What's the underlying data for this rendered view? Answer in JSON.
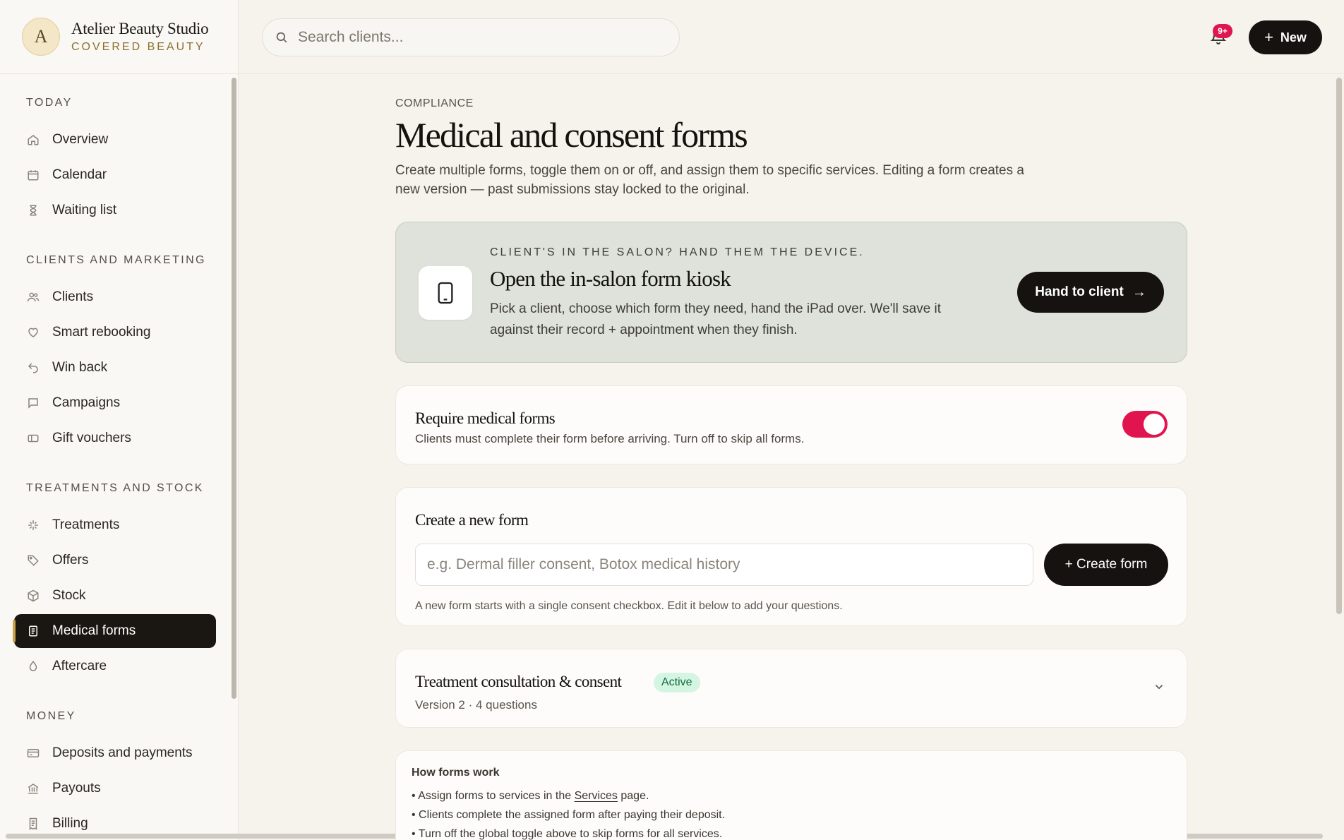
{
  "brand": {
    "initial": "A",
    "name": "Atelier Beauty Studio",
    "subtitle": "COVERED BEAUTY"
  },
  "search": {
    "placeholder": "Search clients..."
  },
  "topbar": {
    "notifications_badge": "9+",
    "new_label": "New"
  },
  "sidebar": {
    "sections": [
      {
        "title": "TODAY",
        "items": [
          {
            "label": "Overview",
            "icon": "home-icon"
          },
          {
            "label": "Calendar",
            "icon": "calendar-icon"
          },
          {
            "label": "Waiting list",
            "icon": "hourglass-icon"
          }
        ]
      },
      {
        "title": "CLIENTS AND MARKETING",
        "items": [
          {
            "label": "Clients",
            "icon": "users-icon"
          },
          {
            "label": "Smart rebooking",
            "icon": "heart-icon"
          },
          {
            "label": "Win back",
            "icon": "undo-icon"
          },
          {
            "label": "Campaigns",
            "icon": "message-icon"
          },
          {
            "label": "Gift vouchers",
            "icon": "voucher-icon"
          }
        ]
      },
      {
        "title": "TREATMENTS AND STOCK",
        "items": [
          {
            "label": "Treatments",
            "icon": "sparkle-icon"
          },
          {
            "label": "Offers",
            "icon": "tag-icon"
          },
          {
            "label": "Stock",
            "icon": "box-icon"
          },
          {
            "label": "Medical forms",
            "icon": "document-icon",
            "active": true
          },
          {
            "label": "Aftercare",
            "icon": "drop-icon"
          }
        ]
      },
      {
        "title": "MONEY",
        "items": [
          {
            "label": "Deposits and payments",
            "icon": "card-icon"
          },
          {
            "label": "Payouts",
            "icon": "bank-icon"
          },
          {
            "label": "Billing",
            "icon": "receipt-icon"
          }
        ]
      }
    ]
  },
  "main": {
    "eyebrow": "COMPLIANCE",
    "title": "Medical and consent forms",
    "description": "Create multiple forms, toggle them on or off, and assign them to specific services. Editing a form creates a new version — past submissions stay locked to the original.",
    "kiosk": {
      "eyebrow": "CLIENT'S IN THE SALON? HAND THEM THE DEVICE.",
      "title": "Open the in-salon form kiosk",
      "description": "Pick a client, choose which form they need, hand the iPad over. We'll save it against their record + appointment when they finish.",
      "button_label": "Hand to client"
    },
    "require": {
      "title": "Require medical forms",
      "description": "Clients must complete their form before arriving. Turn off to skip all forms.",
      "enabled": true
    },
    "create": {
      "title": "Create a new form",
      "placeholder": "e.g. Dermal filler consent, Botox medical history",
      "button_label": "+ Create form",
      "hint": "A new form starts with a single consent checkbox. Edit it below to add your questions."
    },
    "forms": [
      {
        "title": "Treatment consultation & consent",
        "status": "Active",
        "meta": "Version 2 · 4 questions"
      }
    ],
    "info": {
      "title": "How forms work",
      "line1_prefix": "• Assign forms to services in the ",
      "line1_link": "Services",
      "line1_suffix": " page.",
      "line2": "• Clients complete the assigned form after paying their deposit.",
      "line3": "• Turn off the global toggle above to skip forms for all services."
    }
  },
  "colors": {
    "accent": "#e0154f",
    "dark": "#15120f",
    "active_badge_bg": "#d5f5e3",
    "kiosk_bg": "#dee2da"
  }
}
